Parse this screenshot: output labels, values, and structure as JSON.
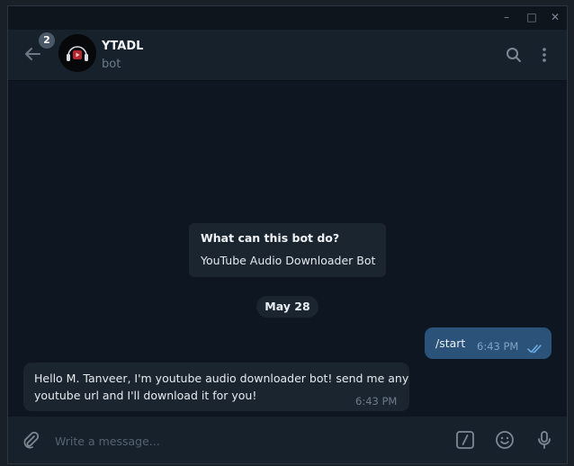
{
  "window": {
    "controls": {
      "minimize": "–",
      "maximize": "□",
      "close": "✕"
    }
  },
  "header": {
    "unread_badge": "2",
    "title": "YTADL",
    "subtitle": "bot",
    "icons": [
      "back-arrow-icon",
      "search-icon",
      "more-vertical-icon"
    ]
  },
  "info_card": {
    "title": "What can this bot do?",
    "text": "YouTube Audio Downloader Bot"
  },
  "date_separator": "May 28",
  "messages": {
    "outgoing": {
      "text": "/start",
      "time": "6:43 PM",
      "status": "read"
    },
    "incoming": {
      "line1": "Hello M. Tanveer, I'm youtube audio downloader bot! send me any",
      "line2": "youtube url and I'll download it for you!",
      "time": "6:43 PM"
    }
  },
  "composer": {
    "placeholder": "Write a message...",
    "value": "",
    "icons": [
      "paperclip-icon",
      "bot-command-icon",
      "emoji-icon",
      "microphone-icon"
    ]
  },
  "colors": {
    "window_bg": "#0f151c",
    "header_bg": "#17212b",
    "chat_bg": "#0e1621",
    "incoming_bubble": "#1b2530",
    "outgoing_bubble": "#2b5278",
    "accent_read_ticks": "#6fb0e8"
  }
}
